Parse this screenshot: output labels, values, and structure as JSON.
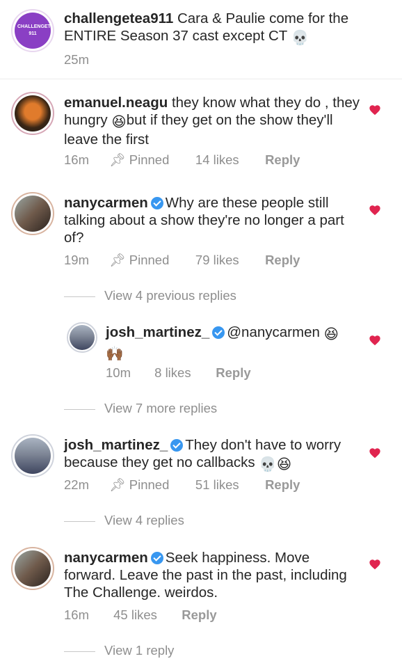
{
  "accent": "#e0244f",
  "verified_color": "#3897f0",
  "comments": [
    {
      "username": "challengetea911",
      "text": "Cara & Paulie come for the ENTIRE Season 37 cast except CT",
      "emoji": "💀",
      "time": "25m",
      "avatar_label": "CHALLENGETEA 911"
    },
    {
      "username": "emanuel.neagu",
      "text_a": "they know what they do , they hungry ",
      "emoji": "😆",
      "text_b": "but if they get on the show they'll leave the first",
      "time": "16m",
      "pinned": "Pinned",
      "likes": "14 likes",
      "reply": "Reply"
    },
    {
      "username": "nanycarmen",
      "text": "Why are these people still talking about a show they're no longer a part of?",
      "time": "19m",
      "pinned": "Pinned",
      "likes": "79 likes",
      "reply": "Reply"
    },
    {
      "view_replies": "View 4 previous replies"
    },
    {
      "username": "josh_martinez_",
      "text": "@nanycarmen",
      "emoji": "😆",
      "emoji2": "🙌🏾",
      "time": "10m",
      "likes": "8 likes",
      "reply": "Reply"
    },
    {
      "view_replies": "View 7 more replies"
    },
    {
      "username": "josh_martinez_",
      "text": "They don't have to worry because they get no callbacks",
      "emoji": "💀😆",
      "time": "22m",
      "pinned": "Pinned",
      "likes": "51 likes",
      "reply": "Reply"
    },
    {
      "view_replies": "View 4 replies"
    },
    {
      "username": "nanycarmen",
      "text": "Seek happiness. Move forward. Leave the past in the past, including The Challenge. weirdos.",
      "time": "16m",
      "likes": "45 likes",
      "reply": "Reply"
    },
    {
      "view_replies": "View 1 reply"
    }
  ]
}
